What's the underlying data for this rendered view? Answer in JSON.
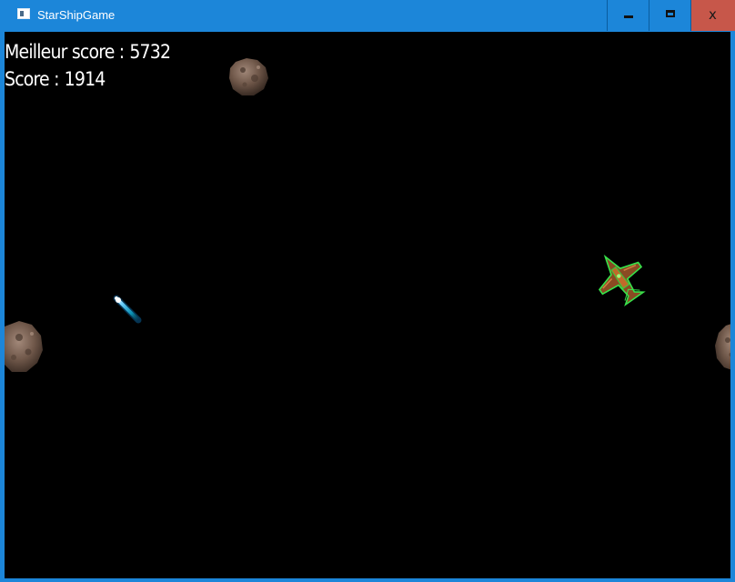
{
  "window": {
    "title": "StarShipGame",
    "minimize_icon": "minimize-icon",
    "maximize_icon": "maximize-icon",
    "close_icon": "close-icon",
    "close_glyph": "x",
    "close_color": "#c7574a",
    "titlebar_color": "#1c86d9"
  },
  "hud": {
    "best_label": "Meilleur score :",
    "best_value": "5732",
    "score_label": "Score :",
    "score_value": "1914"
  },
  "game": {
    "background": "#000000",
    "sprites": [
      "asteroid",
      "asteroid",
      "asteroid",
      "laser-bolt",
      "enemy-starship"
    ]
  }
}
